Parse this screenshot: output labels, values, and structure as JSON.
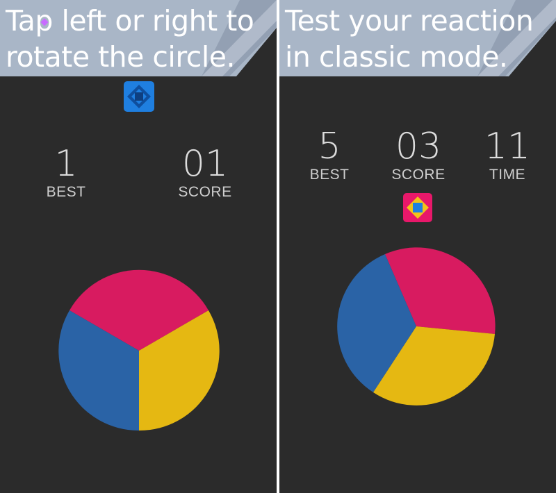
{
  "screens": [
    {
      "caption": [
        "Tap left or right to",
        "rotate the circle."
      ],
      "stats": [
        {
          "value": "1",
          "label": "BEST"
        },
        {
          "value": "01",
          "label": "SCORE"
        }
      ],
      "icon": {
        "name": "blue-diamond-app-icon",
        "color": "#1f7fe0"
      }
    },
    {
      "caption": [
        "Test your reaction",
        "in classic mode."
      ],
      "stats": [
        {
          "value": "5",
          "label": "BEST"
        },
        {
          "value": "03",
          "label": "SCORE"
        },
        {
          "value": "11",
          "label": "TIME"
        }
      ],
      "icon": {
        "name": "pink-diamond-app-icon",
        "color": "#e8186a"
      }
    }
  ],
  "colors": {
    "background": "#2b2b2b",
    "pink": "#d81b60",
    "blue": "#2a63a6",
    "yellow": "#e5b812",
    "banner_light": "#a9b6c7",
    "banner_dark": "#7f8ea2"
  }
}
